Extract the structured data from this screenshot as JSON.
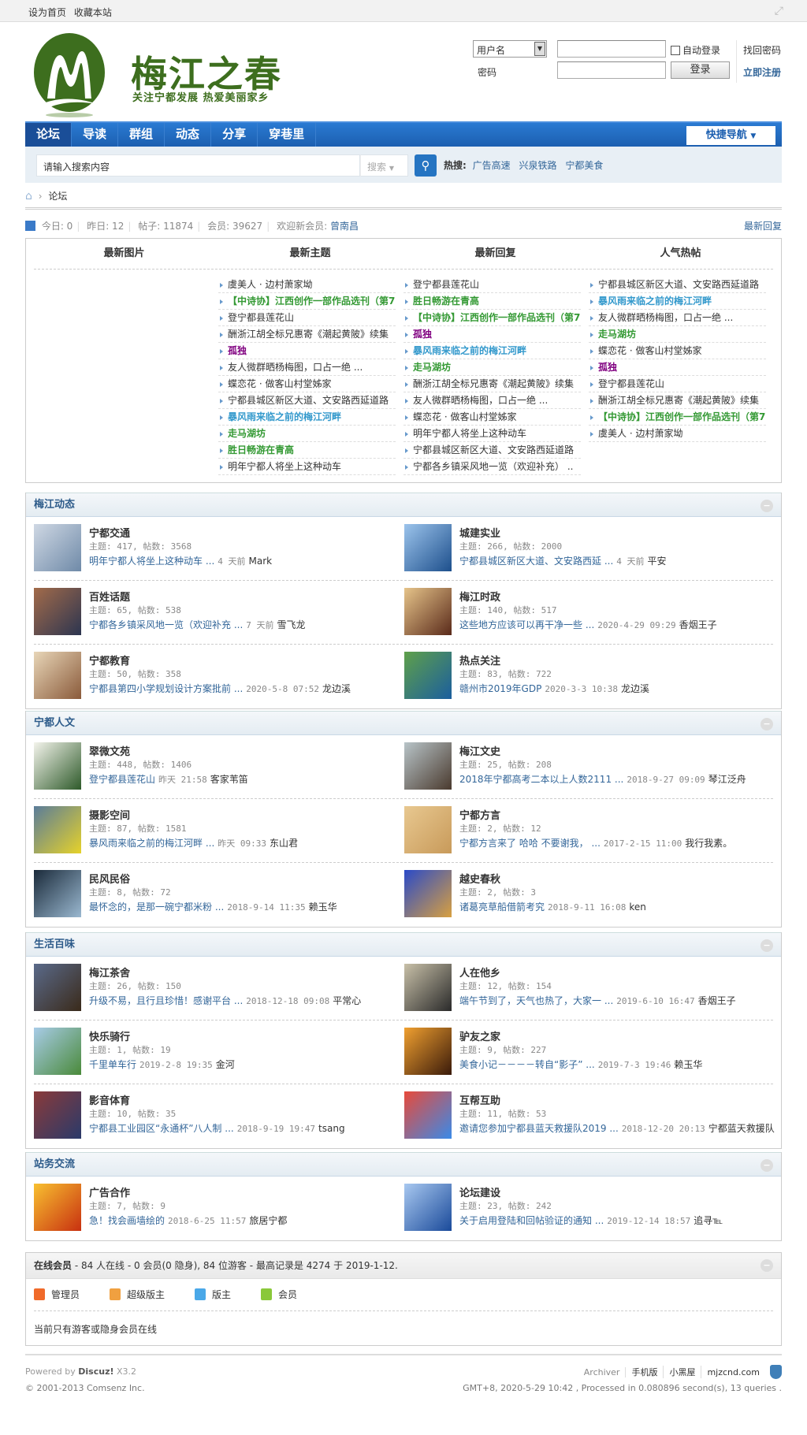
{
  "topbar": {
    "links": [
      "设为首页",
      "收藏本站"
    ]
  },
  "header": {
    "title": "梅江之春",
    "slogan": "关注宁都发展 热爱美丽家乡"
  },
  "login": {
    "type_select": "用户名",
    "password_label": "密码",
    "auto_login": "自动登录",
    "login_button": "登录",
    "forgot": "找回密码",
    "register": "立即注册"
  },
  "nav": {
    "items": [
      "论坛",
      "导读",
      "群组",
      "动态",
      "分享",
      "穿巷里"
    ],
    "quick_nav": "快捷导航"
  },
  "search": {
    "placeholder": "请输入搜索内容",
    "type": "搜索",
    "hot_label": "热搜:",
    "hot": [
      "广告高速",
      "兴泉铁路",
      "宁都美食"
    ]
  },
  "breadcrumb": {
    "current": "论坛"
  },
  "stats": {
    "today": "今日: 0",
    "yesterday": "昨日: 12",
    "posts": "帖子: 11874",
    "members": "会员: 39627",
    "newest_label": "欢迎新会员:",
    "newest": "曾南昌",
    "latest_reply": "最新回复"
  },
  "portal": {
    "columns": [
      {
        "title": "最新图片",
        "items": []
      },
      {
        "title": "最新主题",
        "items": [
          {
            "t": "虞美人 · 边村萧家坳",
            "c": ""
          },
          {
            "t": "【中诗协】江西创作一部作品选刊（第7",
            "c": "green"
          },
          {
            "t": "登宁都县莲花山",
            "c": ""
          },
          {
            "t": "酬浙江胡全标兄惠寄《潮起黄陂》续集",
            "c": ""
          },
          {
            "t": "孤独",
            "c": "purple"
          },
          {
            "t": "友人微群晒杨梅图，口占一绝 ...",
            "c": ""
          },
          {
            "t": "蝶恋花 · 做客山村堂姊家",
            "c": ""
          },
          {
            "t": "宁都县城区新区大道、文安路西延道路",
            "c": ""
          },
          {
            "t": "暴风雨来临之前的梅江河畔",
            "c": "blue"
          },
          {
            "t": "走马湖坊",
            "c": "green"
          },
          {
            "t": "胜日畅游在青高",
            "c": "green"
          },
          {
            "t": "明年宁都人将坐上这种动车",
            "c": ""
          }
        ]
      },
      {
        "title": "最新回复",
        "items": [
          {
            "t": "登宁都县莲花山",
            "c": ""
          },
          {
            "t": "胜日畅游在青高",
            "c": "green"
          },
          {
            "t": "【中诗协】江西创作一部作品选刊（第7",
            "c": "green"
          },
          {
            "t": "孤独",
            "c": "purple"
          },
          {
            "t": "暴风雨来临之前的梅江河畔",
            "c": "blue"
          },
          {
            "t": "走马湖坊",
            "c": "green"
          },
          {
            "t": "酬浙江胡全标兄惠寄《潮起黄陂》续集",
            "c": ""
          },
          {
            "t": "友人微群晒杨梅图，口占一绝 ...",
            "c": ""
          },
          {
            "t": "蝶恋花 · 做客山村堂姊家",
            "c": ""
          },
          {
            "t": "明年宁都人将坐上这种动车",
            "c": ""
          },
          {
            "t": "宁都县城区新区大道、文安路西延道路",
            "c": ""
          },
          {
            "t": "宁都各乡镇采风地一览（欢迎补充） ..",
            "c": ""
          }
        ]
      },
      {
        "title": "人气热帖",
        "items": [
          {
            "t": "宁都县城区新区大道、文安路西延道路",
            "c": ""
          },
          {
            "t": "暴风雨来临之前的梅江河畔",
            "c": "blue"
          },
          {
            "t": "友人微群晒杨梅图，口占一绝 ...",
            "c": ""
          },
          {
            "t": "走马湖坊",
            "c": "green"
          },
          {
            "t": "蝶恋花 · 做客山村堂姊家",
            "c": ""
          },
          {
            "t": "孤独",
            "c": "purple"
          },
          {
            "t": "登宁都县莲花山",
            "c": ""
          },
          {
            "t": "酬浙江胡全标兄惠寄《潮起黄陂》续集",
            "c": ""
          },
          {
            "t": "【中诗协】江西创作一部作品选刊（第7",
            "c": "green"
          },
          {
            "t": "虞美人 · 边村萧家坳",
            "c": ""
          }
        ]
      }
    ]
  },
  "sections": [
    {
      "title": "梅江动态",
      "forums": [
        {
          "name": "宁都交通",
          "stats": "主题: 417, 帖数: 3568",
          "last": "明年宁都人将坐上这种动车 ...",
          "time": "4 天前",
          "author": "Mark",
          "colors": [
            "#cfd8e4",
            "#6f8aa8"
          ]
        },
        {
          "name": "城建实业",
          "stats": "主题: 266, 帖数: 2000",
          "last": "宁都县城区新区大道、文安路西延 ...",
          "time": "4 天前",
          "author": "平安",
          "colors": [
            "#9cc4ec",
            "#1d4f8c"
          ]
        },
        {
          "name": "百姓话题",
          "stats": "主题: 65, 帖数: 538",
          "last": "宁都各乡镇采风地一览（欢迎补充 ...",
          "time": "7 天前",
          "author": "雪飞龙",
          "colors": [
            "#a36b4a",
            "#2c3550"
          ]
        },
        {
          "name": "梅江时政",
          "stats": "主题: 140, 帖数: 517",
          "last": "这些地方应该可以再干净一些 ...",
          "time": "2020-4-29 09:29",
          "author": "香烟王子",
          "colors": [
            "#e6c48a",
            "#5a2a1a"
          ]
        },
        {
          "name": "宁都教育",
          "stats": "主题: 50, 帖数: 358",
          "last": "宁都县第四小学规划设计方案批前 ...",
          "time": "2020-5-8 07:52",
          "author": "龙边溪",
          "colors": [
            "#e8d6b8",
            "#8a5a3a"
          ]
        },
        {
          "name": "热点关注",
          "stats": "主题: 83, 帖数: 722",
          "last": "赣州市2019年GDP",
          "time": "2020-3-3 10:38",
          "author": "龙边溪",
          "colors": [
            "#5fa04a",
            "#1b5e9e"
          ]
        }
      ]
    },
    {
      "title": "宁都人文",
      "forums": [
        {
          "name": "翠微文苑",
          "stats": "主题: 448, 帖数: 1406",
          "last": "登宁都县莲花山",
          "time": "昨天 21:58",
          "author": "客家苇笛",
          "colors": [
            "#f4f4ec",
            "#2e5a2a"
          ]
        },
        {
          "name": "梅江文史",
          "stats": "主题: 25, 帖数: 208",
          "last": "2018年宁都高考二本以上人数2111 ...",
          "time": "2018-9-27 09:09",
          "author": "琴江泛舟",
          "colors": [
            "#b8c4c8",
            "#4a3a2e"
          ]
        },
        {
          "name": "摄影空间",
          "stats": "主题: 87, 帖数: 1581",
          "last": "暴风雨来临之前的梅江河畔 ...",
          "time": "昨天 09:33",
          "author": "东山君",
          "colors": [
            "#5a7c9a",
            "#e6d22a"
          ]
        },
        {
          "name": "宁都方言",
          "stats": "主题: 2, 帖数: 12",
          "last": "宁都方言来了 哈哈 不要谢我， ...",
          "time": "2017-2-15 11:00",
          "author": "我行我素。",
          "colors": [
            "#e8c890",
            "#c89a5a"
          ]
        },
        {
          "name": "民风民俗",
          "stats": "主题: 8, 帖数: 72",
          "last": "最怀念的，是那一碗宁都米粉 ...",
          "time": "2018-9-14 11:35",
          "author": "赖玉华",
          "colors": [
            "#1a2a3a",
            "#9ab8d0"
          ]
        },
        {
          "name": "越史春秋",
          "stats": "主题: 2, 帖数: 3",
          "last": "诸葛亮草船借箭考究",
          "time": "2018-9-11 16:08",
          "author": "ken",
          "colors": [
            "#2a4ac8",
            "#d8a040"
          ]
        }
      ]
    },
    {
      "title": "生活百味",
      "forums": [
        {
          "name": "梅江茶舍",
          "stats": "主题: 26, 帖数: 150",
          "last": "升级不易，且行且珍惜！感谢平台 ...",
          "time": "2018-12-18 09:08",
          "author": "平常心",
          "colors": [
            "#5a6a8a",
            "#3a2a1a"
          ]
        },
        {
          "name": "人在他乡",
          "stats": "主题: 12, 帖数: 154",
          "last": "端午节到了，天气也热了，大家一 ...",
          "time": "2019-6-10 16:47",
          "author": "香烟王子",
          "colors": [
            "#c8c0a8",
            "#2a2a2a"
          ]
        },
        {
          "name": "快乐骑行",
          "stats": "主题: 1, 帖数: 19",
          "last": "千里单车行",
          "time": "2019-2-8 19:35",
          "author": "金河",
          "colors": [
            "#a8cce8",
            "#4a8a3a"
          ]
        },
        {
          "name": "驴友之家",
          "stats": "主题: 9, 帖数: 227",
          "last": "美食小记－－－－转自“影子” ...",
          "time": "2019-7-3 19:46",
          "author": "赖玉华",
          "colors": [
            "#f0a030",
            "#3a1a0a"
          ]
        },
        {
          "name": "影音体育",
          "stats": "主题: 10, 帖数: 35",
          "last": "宁都县工业园区“永通杯”八人制 ...",
          "time": "2018-9-19 19:47",
          "author": "tsang",
          "colors": [
            "#8a3a3a",
            "#2a3a6a"
          ]
        },
        {
          "name": "互帮互助",
          "stats": "主题: 11, 帖数: 53",
          "last": "邀请您参加宁都县蓝天救援队2019 ...",
          "time": "2018-12-20 20:13",
          "author": "宁都蓝天救援队",
          "colors": [
            "#e84a3a",
            "#3a8ae8"
          ]
        }
      ]
    },
    {
      "title": "站务交流",
      "forums": [
        {
          "name": "广告合作",
          "stats": "主题: 7, 帖数: 9",
          "last": "急！找会画墙绘的",
          "time": "2018-6-25 11:57",
          "author": "旅居宁都",
          "colors": [
            "#f8c030",
            "#c83010"
          ]
        },
        {
          "name": "论坛建设",
          "stats": "主题: 23, 帖数: 242",
          "last": "关于启用登陆和回帖验证的通知 ...",
          "time": "2019-12-14 18:57",
          "author": "追寻℡",
          "colors": [
            "#a8c8f0",
            "#1a4a9a"
          ]
        }
      ]
    }
  ],
  "online": {
    "title": "在线会员",
    "summary": " - 84 人在线 - 0 会员(0 隐身), 84 位游客 - 最高记录是 4274 于 2019-1-12.",
    "legend": [
      {
        "label": "管理员",
        "color": "#f06a2a"
      },
      {
        "label": "超级版主",
        "color": "#f0a040"
      },
      {
        "label": "版主",
        "color": "#4aa8e8"
      },
      {
        "label": "会员",
        "color": "#8ac83a"
      }
    ],
    "note": "当前只有游客或隐身会员在线"
  },
  "footer": {
    "powered": "Powered by",
    "product": "Discuz!",
    "version": "X3.2",
    "copyright": "© 2001-2013 Comsenz Inc.",
    "links": [
      "Archiver",
      "手机版",
      "小黑屋",
      "mjzcnd.com"
    ],
    "info": "GMT+8, 2020-5-29 10:42 , Processed in 0.080896 second(s), 13 queries ."
  },
  "colors": {
    "nav": "#1c5fb0",
    "link": "#336699",
    "brand": "#3d6e1e"
  }
}
